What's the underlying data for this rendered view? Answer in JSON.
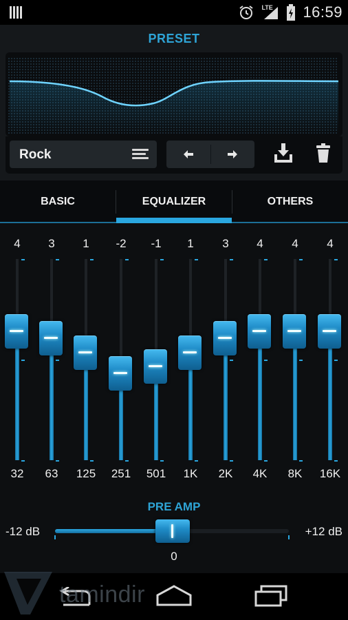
{
  "status_bar": {
    "time": "16:59",
    "network_label": "LTE",
    "icons": [
      "notification-icon",
      "alarm-icon",
      "signal-icon",
      "battery-charging-icon"
    ]
  },
  "preset": {
    "title": "PRESET",
    "current": "Rock",
    "icons": [
      "preset-menu-icon",
      "prev-arrow-icon",
      "next-arrow-icon",
      "save-download-icon",
      "trash-icon"
    ]
  },
  "tabs": [
    {
      "label": "BASIC",
      "selected": false
    },
    {
      "label": "EQUALIZER",
      "selected": true
    },
    {
      "label": "OTHERS",
      "selected": false
    }
  ],
  "equalizer": {
    "range_db": [
      -12,
      12
    ],
    "bands": [
      {
        "freq": "32",
        "gain": "4"
      },
      {
        "freq": "63",
        "gain": "3"
      },
      {
        "freq": "125",
        "gain": "1"
      },
      {
        "freq": "251",
        "gain": "-2"
      },
      {
        "freq": "501",
        "gain": "-1"
      },
      {
        "freq": "1K",
        "gain": "1"
      },
      {
        "freq": "2K",
        "gain": "3"
      },
      {
        "freq": "4K",
        "gain": "4"
      },
      {
        "freq": "8K",
        "gain": "4"
      },
      {
        "freq": "16K",
        "gain": "4"
      }
    ]
  },
  "preamp": {
    "title": "PRE AMP",
    "min_label": "-12 dB",
    "max_label": "+12 dB",
    "value": "0",
    "fraction": 0.5
  },
  "nav_bar": {
    "icons": [
      "back-icon",
      "home-icon",
      "recents-icon"
    ]
  },
  "watermark": {
    "text": "tamindir",
    "icon": "tamindir-logo-icon"
  },
  "colors": {
    "accent": "#2aa7e0",
    "title": "#2ea4d6",
    "background": "#0d0f11"
  }
}
